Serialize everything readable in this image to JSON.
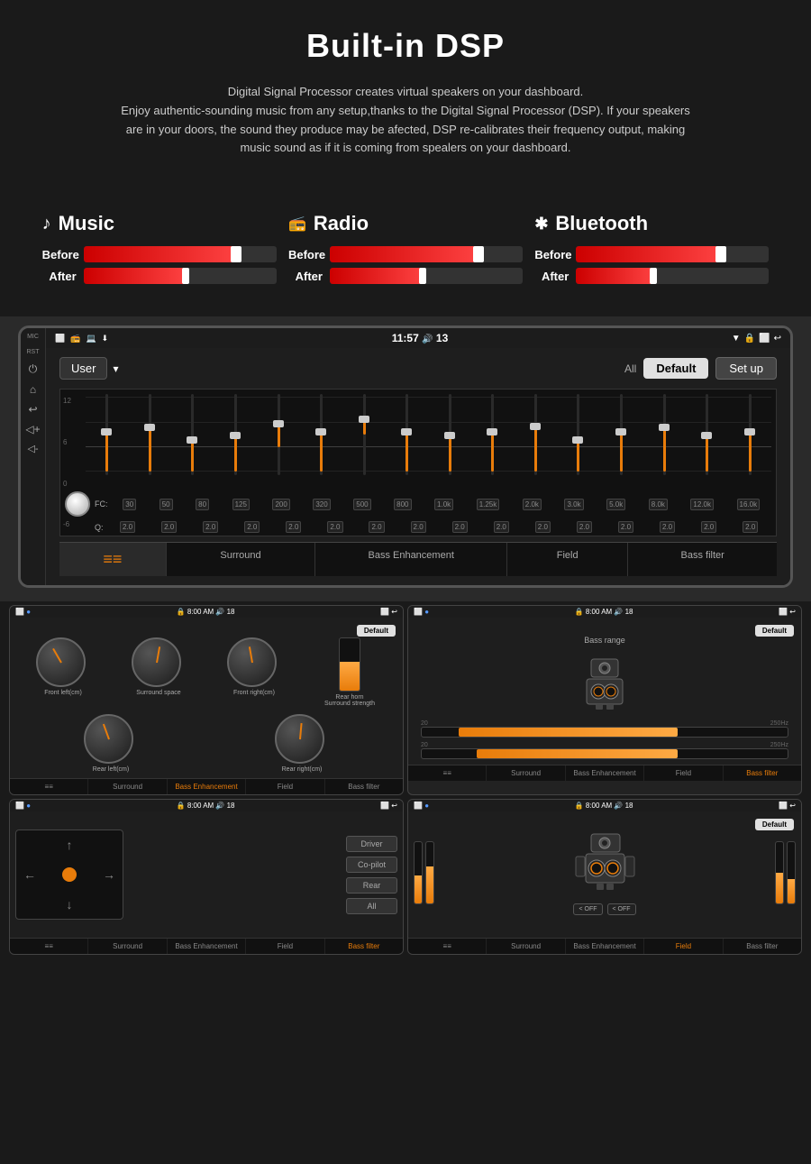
{
  "page": {
    "title": "Built-in DSP",
    "description_line1": "Digital Signal Processor creates virtual speakers on your dashboard.",
    "description_line2": "Enjoy authentic-sounding music from any setup,thanks to the Digital Signal Processor (DSP). If your speakers",
    "description_line3": "are in your doors, the sound they produce may be afected, DSP re-calibrates their frequency output, making",
    "description_line4": "music sound as if it is coming from spealers on your dashboard."
  },
  "comparison": {
    "music": {
      "icon": "♪",
      "label": "Music",
      "before_label": "Before",
      "after_label": "After",
      "before_width": "82%",
      "after_width": "55%"
    },
    "radio": {
      "icon": "📻",
      "label": "Radio",
      "before_label": "Before",
      "after_label": "After",
      "before_width": "80%",
      "after_width": "50%"
    },
    "bluetooth": {
      "icon": "⚡",
      "label": "Bluetooth",
      "before_label": "Before",
      "after_label": "After",
      "before_width": "78%",
      "after_width": "42%"
    }
  },
  "dsp_screen": {
    "statusbar": {
      "mic": "MIC",
      "time": "11:57",
      "battery": "13",
      "left_icons": [
        "⬜",
        "📻",
        "💻",
        "⬇"
      ],
      "right_icons": [
        "▼",
        "🔒",
        "🔊"
      ]
    },
    "preset": "User",
    "all_label": "All",
    "default_btn": "Default",
    "setup_btn": "Set up",
    "eq": {
      "grid_labels": [
        "12",
        "6",
        "0",
        "-6"
      ],
      "frequencies": [
        "30",
        "50",
        "80",
        "125",
        "200",
        "320",
        "500",
        "800",
        "1.0k",
        "1.25k",
        "2.0k",
        "3.0k",
        "5.0k",
        "8.0k",
        "12.0k",
        "16.0k"
      ],
      "fc_label": "FC:",
      "q_label": "Q:",
      "q_values": [
        "2.0",
        "2.0",
        "2.0",
        "2.0",
        "2.0",
        "2.0",
        "2.0",
        "2.0",
        "2.0",
        "2.0",
        "2.0",
        "2.0",
        "2.0",
        "2.0",
        "2.0",
        "2.0"
      ],
      "slider_positions": [
        0,
        0,
        -10,
        -5,
        5,
        0,
        10,
        0,
        -5,
        0,
        5,
        -10,
        0,
        5,
        -5,
        0
      ]
    },
    "tabs": [
      {
        "label": "",
        "icon": "≡≡",
        "active": true
      },
      {
        "label": "Surround",
        "active": false
      },
      {
        "label": "Bass Enhancement",
        "active": false
      },
      {
        "label": "Field",
        "active": false
      },
      {
        "label": "Bass filter",
        "active": false
      }
    ]
  },
  "screenshots": [
    {
      "id": "surround",
      "time": "8:00 AM",
      "battery": "18",
      "default_btn": "Default",
      "dials": [
        {
          "label": "Front left(cm)"
        },
        {
          "label": "Surround space"
        },
        {
          "label": "Front right(cm)"
        },
        {
          "label": "Rear horn\nSurround\nstrength"
        },
        {
          "label": "Rear left(cm)"
        },
        {
          "label": "Rear right(cm)"
        }
      ],
      "tabs": [
        "≡≡",
        "Surround",
        "Bass Enhancement",
        "Field",
        "Bass filter"
      ],
      "active_tab": "Bass Enhancement"
    },
    {
      "id": "bass-range",
      "time": "8:00 AM",
      "battery": "18",
      "default_btn": "Default",
      "title": "Bass range",
      "slider1_labels": [
        "20Hz",
        "250Hz"
      ],
      "slider2_labels": [
        "20Hz",
        "250Hz"
      ],
      "tabs": [
        "≡≡",
        "Surround",
        "Bass Enhancement",
        "Field",
        "Bass filter"
      ],
      "active_tab": "Bass filter"
    },
    {
      "id": "field",
      "time": "8:00 AM",
      "battery": "18",
      "buttons": [
        "Driver",
        "Co-pilot",
        "Rear",
        "All"
      ],
      "tabs": [
        "≡≡",
        "Surround",
        "Bass Enhancement",
        "Field",
        "Bass filter"
      ],
      "active_tab": "Bass filter"
    },
    {
      "id": "surround2",
      "time": "8:00 AM",
      "battery": "18",
      "default_btn": "Default",
      "off_btn1": "< OFF",
      "off_btn2": "< OFF",
      "tabs": [
        "≡≡",
        "Surround",
        "Bass Enhancement",
        "Field",
        "Bass filter"
      ],
      "active_tab": "Field"
    }
  ],
  "colors": {
    "accent": "#e87c0a",
    "bg_dark": "#1a1a1a",
    "bg_screen": "#1e1e1e",
    "text_light": "#ffffff",
    "text_muted": "#888888",
    "bar_red": "#cc0000"
  }
}
